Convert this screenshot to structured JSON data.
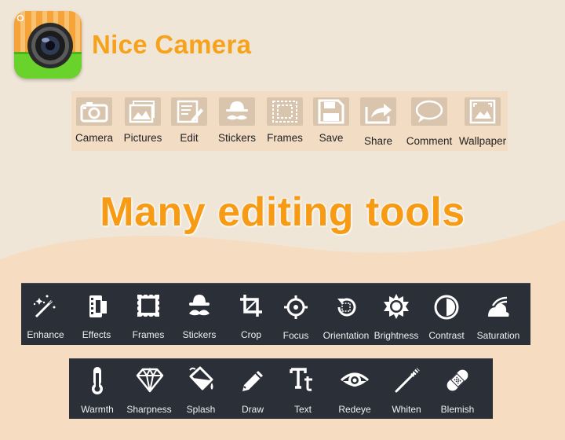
{
  "app": {
    "title": "Nice Camera",
    "icon": "camera-lens-icon",
    "colors": {
      "title": "#f7a21b",
      "icon_stripes": "#f6a43a",
      "icon_base": "#6ad32b"
    }
  },
  "top_toolbar": {
    "items": [
      {
        "label": "Camera",
        "icon": "camera-icon"
      },
      {
        "label": "Pictures",
        "icon": "pictures-icon"
      },
      {
        "label": "Edit",
        "icon": "edit-icon"
      },
      {
        "label": "Stickers",
        "icon": "stickers-icon"
      },
      {
        "label": "Frames",
        "icon": "frames-icon"
      },
      {
        "label": "Save",
        "icon": "save-icon"
      },
      {
        "label": "Share",
        "icon": "share-icon"
      },
      {
        "label": "Comment",
        "icon": "comment-icon"
      },
      {
        "label": "Wallpaper",
        "icon": "wallpaper-icon"
      }
    ]
  },
  "headline": "Many editing tools",
  "tools_row1": [
    {
      "label": "Enhance",
      "icon": "magic-wand-icon"
    },
    {
      "label": "Effects",
      "icon": "film-icon"
    },
    {
      "label": "Frames",
      "icon": "frame-icon"
    },
    {
      "label": "Stickers",
      "icon": "hat-mustache-icon"
    },
    {
      "label": "Crop",
      "icon": "crop-icon"
    },
    {
      "label": "Focus",
      "icon": "focus-icon"
    },
    {
      "label": "Orientation",
      "icon": "rotate-icon"
    },
    {
      "label": "Brightness",
      "icon": "sun-icon"
    },
    {
      "label": "Contrast",
      "icon": "contrast-icon"
    },
    {
      "label": "Saturation",
      "icon": "saturation-icon"
    }
  ],
  "tools_row2": [
    {
      "label": "Warmth",
      "icon": "thermometer-icon"
    },
    {
      "label": "Sharpness",
      "icon": "diamond-icon"
    },
    {
      "label": "Splash",
      "icon": "paint-bucket-icon"
    },
    {
      "label": "Draw",
      "icon": "pencil-icon"
    },
    {
      "label": "Text",
      "icon": "text-icon"
    },
    {
      "label": "Redeye",
      "icon": "eye-icon"
    },
    {
      "label": "Whiten",
      "icon": "toothbrush-icon"
    },
    {
      "label": "Blemish",
      "icon": "bandage-icon"
    }
  ],
  "colors": {
    "background": "#efe6d8",
    "wave": "#f6dcc0",
    "headline": "#f79a14",
    "tool_bar": "#2b2f38",
    "top_bar": "#f3dcc4"
  }
}
